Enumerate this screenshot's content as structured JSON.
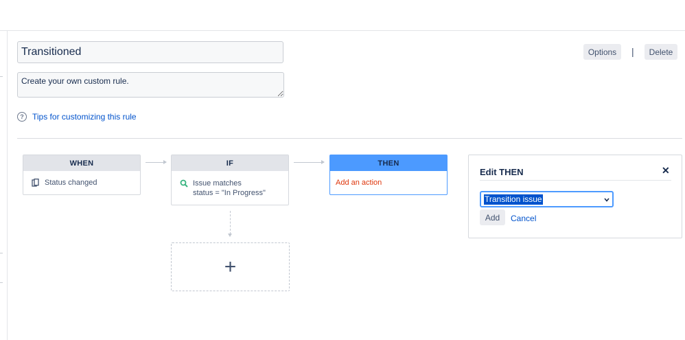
{
  "rule": {
    "title": "Transitioned",
    "description": "Create your own custom rule."
  },
  "actions": {
    "options_label": "Options",
    "separator": "|",
    "delete_label": "Delete"
  },
  "tips": {
    "link_text": "Tips for customizing this rule"
  },
  "flow": {
    "when": {
      "header": "WHEN",
      "item": "Status changed",
      "icon": "status-change-icon"
    },
    "if": {
      "header": "IF",
      "line1": "Issue matches",
      "line2": "status = \"In Progress\"",
      "icon": "search-icon"
    },
    "then": {
      "header": "THEN",
      "item": "Add an action"
    },
    "add_component": "+"
  },
  "edit_panel": {
    "title": "Edit THEN",
    "close_glyph": "✕",
    "selected_action": "Transition issue",
    "add_label": "Add",
    "cancel_label": "Cancel"
  },
  "colors": {
    "accent": "#4c9aff",
    "link": "#0052cc",
    "danger_text": "#de350b",
    "card_header": "#e2e4e9"
  }
}
